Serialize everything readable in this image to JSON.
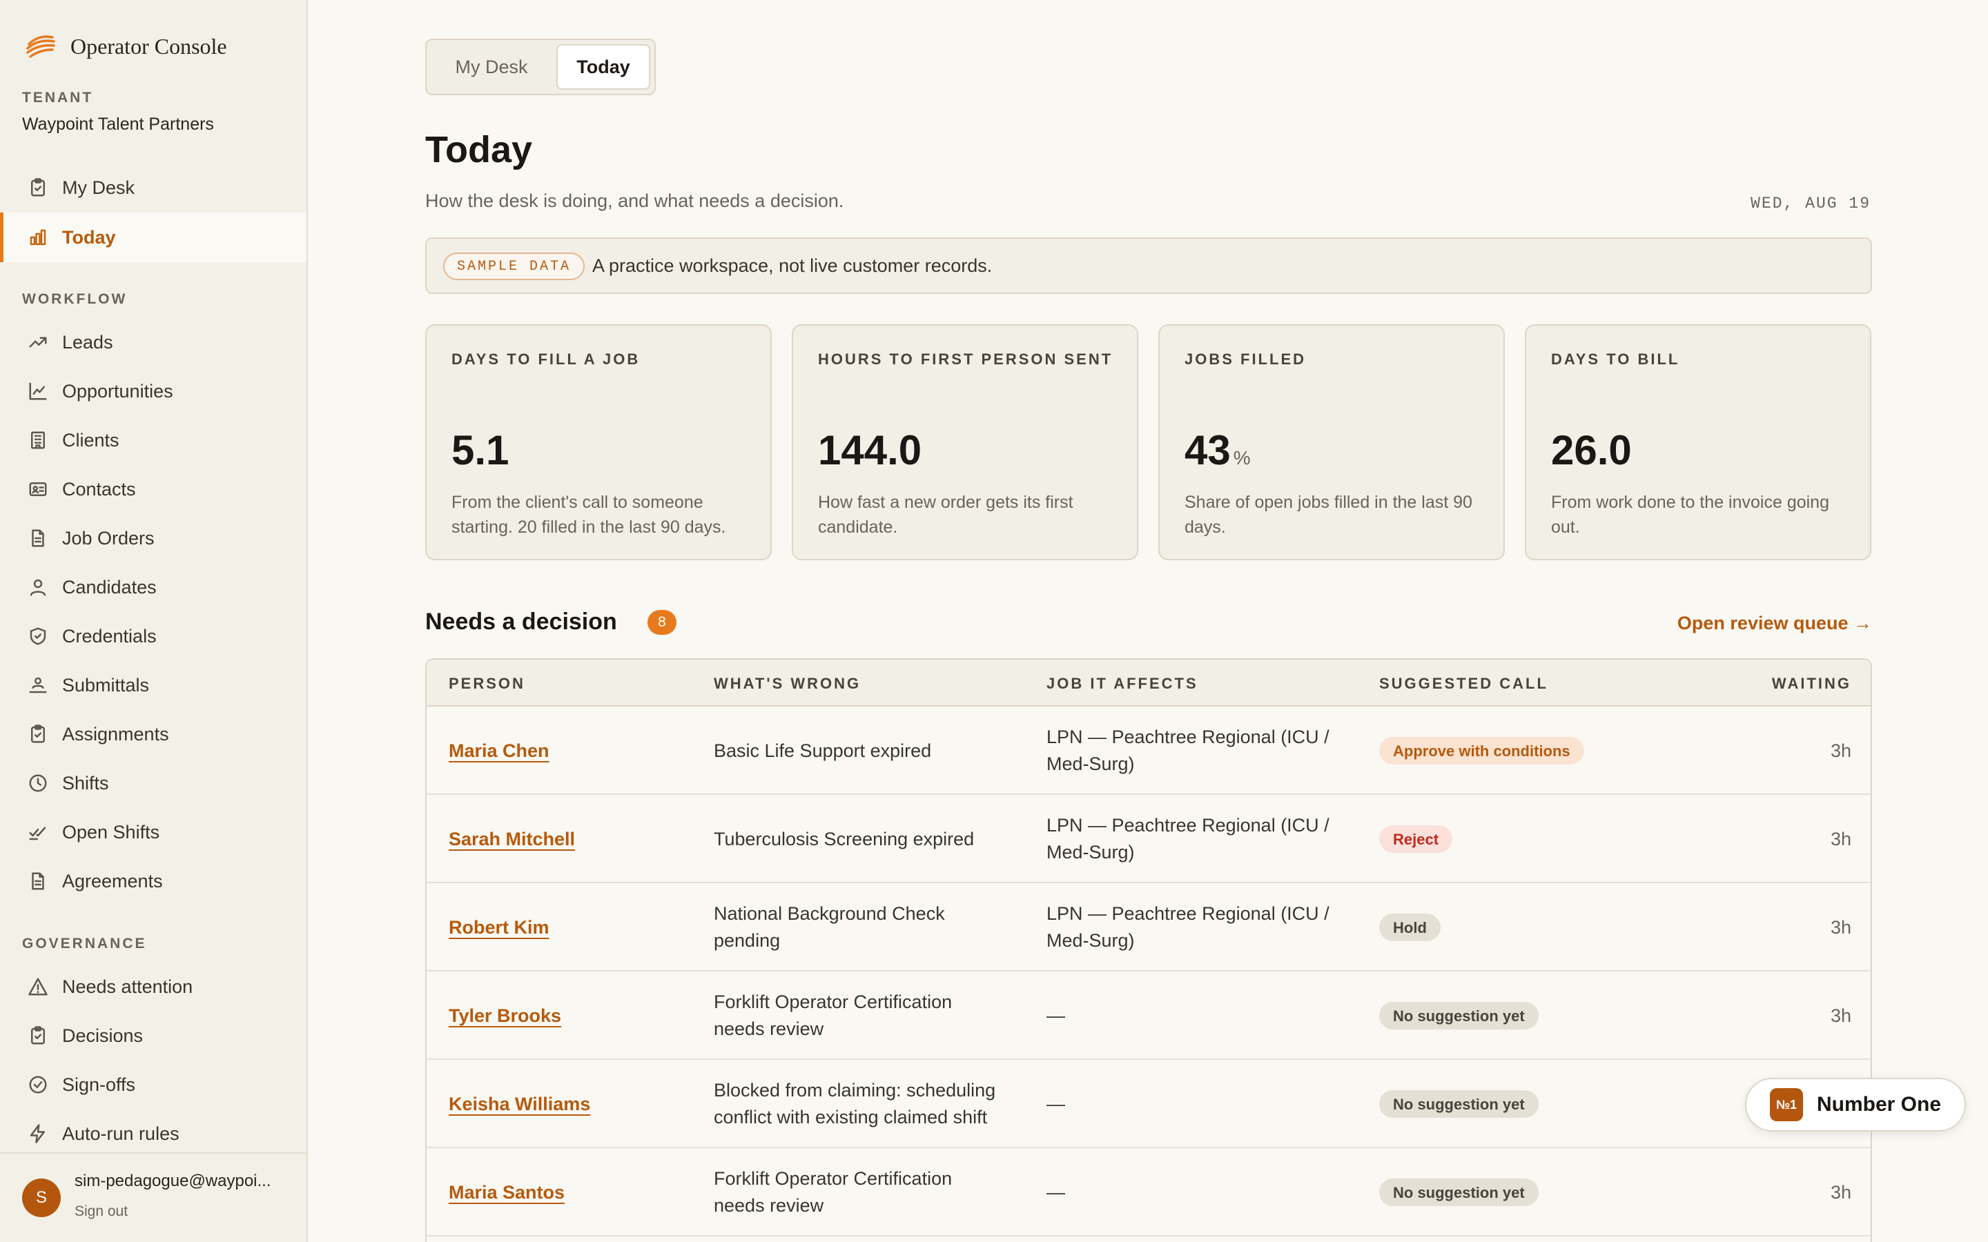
{
  "app": {
    "title": "Operator Console"
  },
  "tenant": {
    "label": "TENANT",
    "name": "Waypoint Talent Partners"
  },
  "nav": {
    "top": [
      {
        "label": "My Desk",
        "icon": "clipboard-icon"
      },
      {
        "label": "Today",
        "icon": "bar-chart-icon",
        "active": true
      }
    ],
    "workflow_label": "WORKFLOW",
    "workflow": [
      {
        "label": "Leads",
        "icon": "trending-up-icon"
      },
      {
        "label": "Opportunities",
        "icon": "line-chart-icon"
      },
      {
        "label": "Clients",
        "icon": "building-icon"
      },
      {
        "label": "Contacts",
        "icon": "contact-card-icon"
      },
      {
        "label": "Job Orders",
        "icon": "document-icon"
      },
      {
        "label": "Candidates",
        "icon": "user-icon"
      },
      {
        "label": "Credentials",
        "icon": "shield-check-icon"
      },
      {
        "label": "Submittals",
        "icon": "user-submit-icon"
      },
      {
        "label": "Assignments",
        "icon": "clipboard-icon"
      },
      {
        "label": "Shifts",
        "icon": "clock-icon"
      },
      {
        "label": "Open Shifts",
        "icon": "checks-icon"
      },
      {
        "label": "Agreements",
        "icon": "document-icon"
      }
    ],
    "governance_label": "GOVERNANCE",
    "governance": [
      {
        "label": "Needs attention",
        "icon": "warning-icon"
      },
      {
        "label": "Decisions",
        "icon": "clipboard-icon"
      },
      {
        "label": "Sign-offs",
        "icon": "check-circle-icon"
      },
      {
        "label": "Auto-run rules",
        "icon": "lightning-icon"
      }
    ]
  },
  "user": {
    "initial": "S",
    "email": "sim-pedagogue@waypoi...",
    "sign_out": "Sign out"
  },
  "tabs": {
    "my_desk": "My Desk",
    "today": "Today"
  },
  "page": {
    "title": "Today",
    "subtitle": "How the desk is doing, and what needs a decision.",
    "date": "WED, AUG 19"
  },
  "banner": {
    "pill": "SAMPLE DATA",
    "text": "A practice workspace, not live customer records."
  },
  "metrics": [
    {
      "label": "DAYS TO FILL A JOB",
      "value": "5.1",
      "unit": "",
      "desc": "From the client's call to someone starting. 20 filled in the last 90 days."
    },
    {
      "label": "HOURS TO FIRST PERSON SENT",
      "value": "144.0",
      "unit": "",
      "desc": "How fast a new order gets its first candidate."
    },
    {
      "label": "JOBS FILLED",
      "value": "43",
      "unit": "%",
      "desc": "Share of open jobs filled in the last 90 days."
    },
    {
      "label": "DAYS TO BILL",
      "value": "26.0",
      "unit": "",
      "desc": "From work done to the invoice going out."
    }
  ],
  "decisions": {
    "title": "Needs a decision",
    "count": "8",
    "review_link": "Open review queue →",
    "columns": [
      "PERSON",
      "WHAT'S WRONG",
      "JOB IT AFFECTS",
      "SUGGESTED CALL",
      "WAITING"
    ],
    "rows": [
      {
        "person": "Maria Chen",
        "issue": "Basic Life Support expired",
        "job": "LPN — Peachtree Regional (ICU / Med-Surg)",
        "call": "Approve with conditions",
        "tone": "orange",
        "waiting": "3h"
      },
      {
        "person": "Sarah Mitchell",
        "issue": "Tuberculosis Screening expired",
        "job": "LPN — Peachtree Regional (ICU / Med-Surg)",
        "call": "Reject",
        "tone": "red",
        "waiting": "3h"
      },
      {
        "person": "Robert Kim",
        "issue": "National Background Check pending",
        "job": "LPN — Peachtree Regional (ICU / Med-Surg)",
        "call": "Hold",
        "tone": "gray",
        "waiting": "3h"
      },
      {
        "person": "Tyler Brooks",
        "issue": "Forklift Operator Certification needs review",
        "job": "—",
        "call": "No suggestion yet",
        "tone": "gray",
        "waiting": "3h"
      },
      {
        "person": "Keisha Williams",
        "issue": "Blocked from claiming: scheduling conflict with existing claimed shift",
        "job": "—",
        "call": "No suggestion yet",
        "tone": "gray",
        "waiting": ""
      },
      {
        "person": "Maria Santos",
        "issue": "Forklift Operator Certification needs review",
        "job": "—",
        "call": "No suggestion yet",
        "tone": "gray",
        "waiting": "3h"
      }
    ]
  },
  "assistant": {
    "badge": "№1",
    "label": "Number One"
  },
  "colors": {
    "accent": "#e87a1e",
    "accent_text": "#b65a0c",
    "background": "#faf8f3"
  }
}
